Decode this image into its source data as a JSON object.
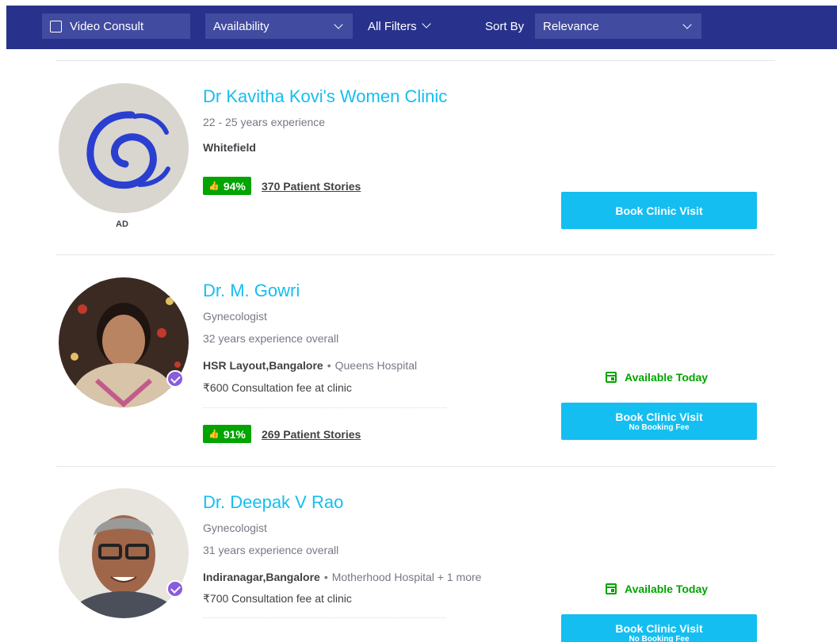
{
  "filter_bar": {
    "video_consult_label": "Video Consult",
    "availability_label": "Availability",
    "all_filters_label": "All Filters",
    "sort_by_label": "Sort By",
    "sort_value": "Relevance"
  },
  "listings": [
    {
      "name": "Dr Kavitha Kovi's Women Clinic",
      "experience": "22 - 25 years experience",
      "location": "Whitefield",
      "rating": "94%",
      "stories": "370 Patient Stories",
      "ad_label": "AD",
      "book_label": "Book Clinic Visit"
    },
    {
      "name": "Dr. M. Gowri",
      "specialty": "Gynecologist",
      "experience": "32 years experience overall",
      "location": "HSR Layout,Bangalore",
      "clinic": "Queens Hospital",
      "fee": "₹600 Consultation fee at clinic",
      "rating": "91%",
      "stories": "269 Patient Stories",
      "availability": "Available Today",
      "book_label": "Book Clinic Visit",
      "book_sub": "No Booking Fee"
    },
    {
      "name": "Dr. Deepak V Rao",
      "specialty": "Gynecologist",
      "experience": "31 years experience overall",
      "location": "Indiranagar,Bangalore",
      "clinic": "Motherhood Hospital + 1 more",
      "fee": "₹700 Consultation fee at clinic",
      "availability": "Available Today",
      "book_label": "Book Clinic Visit",
      "book_sub": "No Booking Fee"
    }
  ],
  "colors": {
    "header_bg": "#28328c",
    "accent_blue": "#14bef0",
    "rating_green": "#01a400",
    "verified_purple": "#8a5cdc"
  }
}
